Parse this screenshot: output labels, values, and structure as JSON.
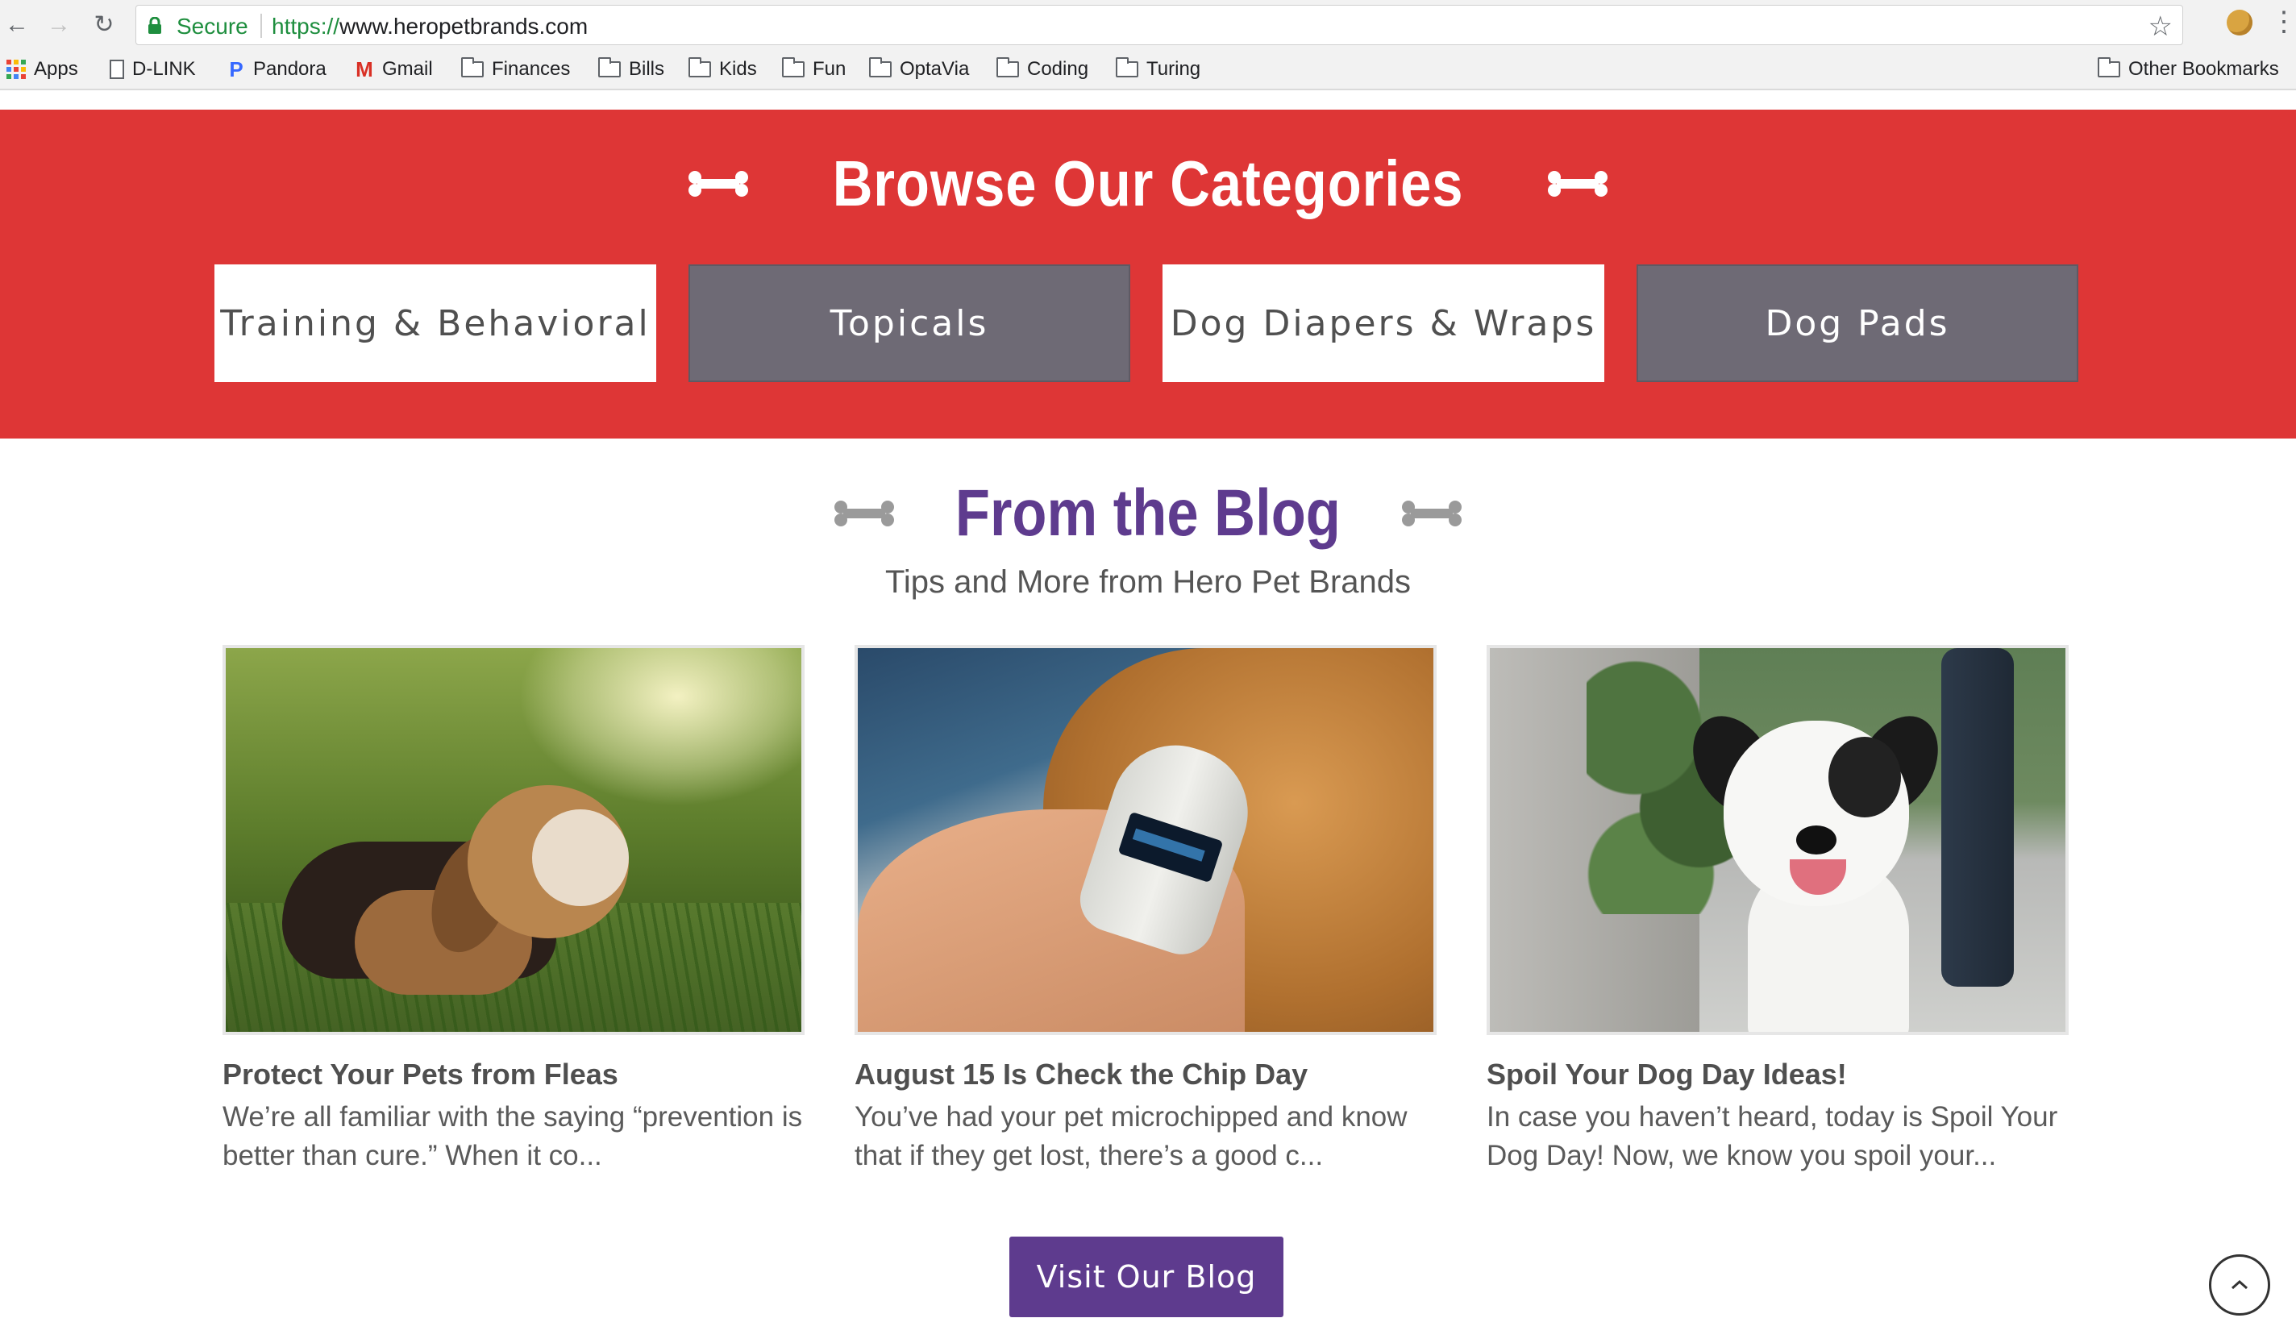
{
  "browser": {
    "secure_label": "Secure",
    "url_scheme": "https://",
    "url_rest": "www.heropetbrands.com",
    "bookmarks": [
      {
        "label": "Apps",
        "icon": "apps-grid-icon"
      },
      {
        "label": "D-LINK",
        "icon": "page-icon"
      },
      {
        "label": "Pandora",
        "icon": "pandora-icon"
      },
      {
        "label": "Gmail",
        "icon": "gmail-icon"
      },
      {
        "label": "Finances",
        "icon": "folder-icon"
      },
      {
        "label": "Bills",
        "icon": "folder-icon"
      },
      {
        "label": "Kids",
        "icon": "folder-icon"
      },
      {
        "label": "Fun",
        "icon": "folder-icon"
      },
      {
        "label": "OptaVia",
        "icon": "folder-icon"
      },
      {
        "label": "Coding",
        "icon": "folder-icon"
      },
      {
        "label": "Turing",
        "icon": "folder-icon"
      }
    ],
    "other_bookmarks": "Other Bookmarks"
  },
  "categories": {
    "title": "Browse Our Categories",
    "items": [
      {
        "label": "Training & Behavioral",
        "style": "light"
      },
      {
        "label": "Topicals",
        "style": "dark"
      },
      {
        "label": "Dog Diapers & Wraps",
        "style": "light"
      },
      {
        "label": "Dog Pads",
        "style": "dark"
      }
    ]
  },
  "blog": {
    "title": "From the Blog",
    "subtitle": "Tips and More from Hero Pet Brands",
    "posts": [
      {
        "title": "Protect Your Pets from Fleas",
        "excerpt": "We’re all familiar with the saying “prevention is better than cure.” When it co...",
        "image": "beagle-scratching-in-grass"
      },
      {
        "title": "August 15 Is Check the Chip Day",
        "excerpt": "You’ve had your pet microchipped and know that if they get lost, there’s a good c...",
        "image": "microchip-scanner-on-dog"
      },
      {
        "title": "Spoil Your Dog Day Ideas!",
        "excerpt": "In case you haven’t heard, today is Spoil Your Dog Day! Now, we know you spoil your...",
        "image": "happy-black-white-dog"
      }
    ],
    "cta_label": "Visit Our Blog"
  },
  "colors": {
    "brand_red": "#de3636",
    "brand_purple": "#5e3b8e",
    "button_gray": "#6e6a75"
  }
}
